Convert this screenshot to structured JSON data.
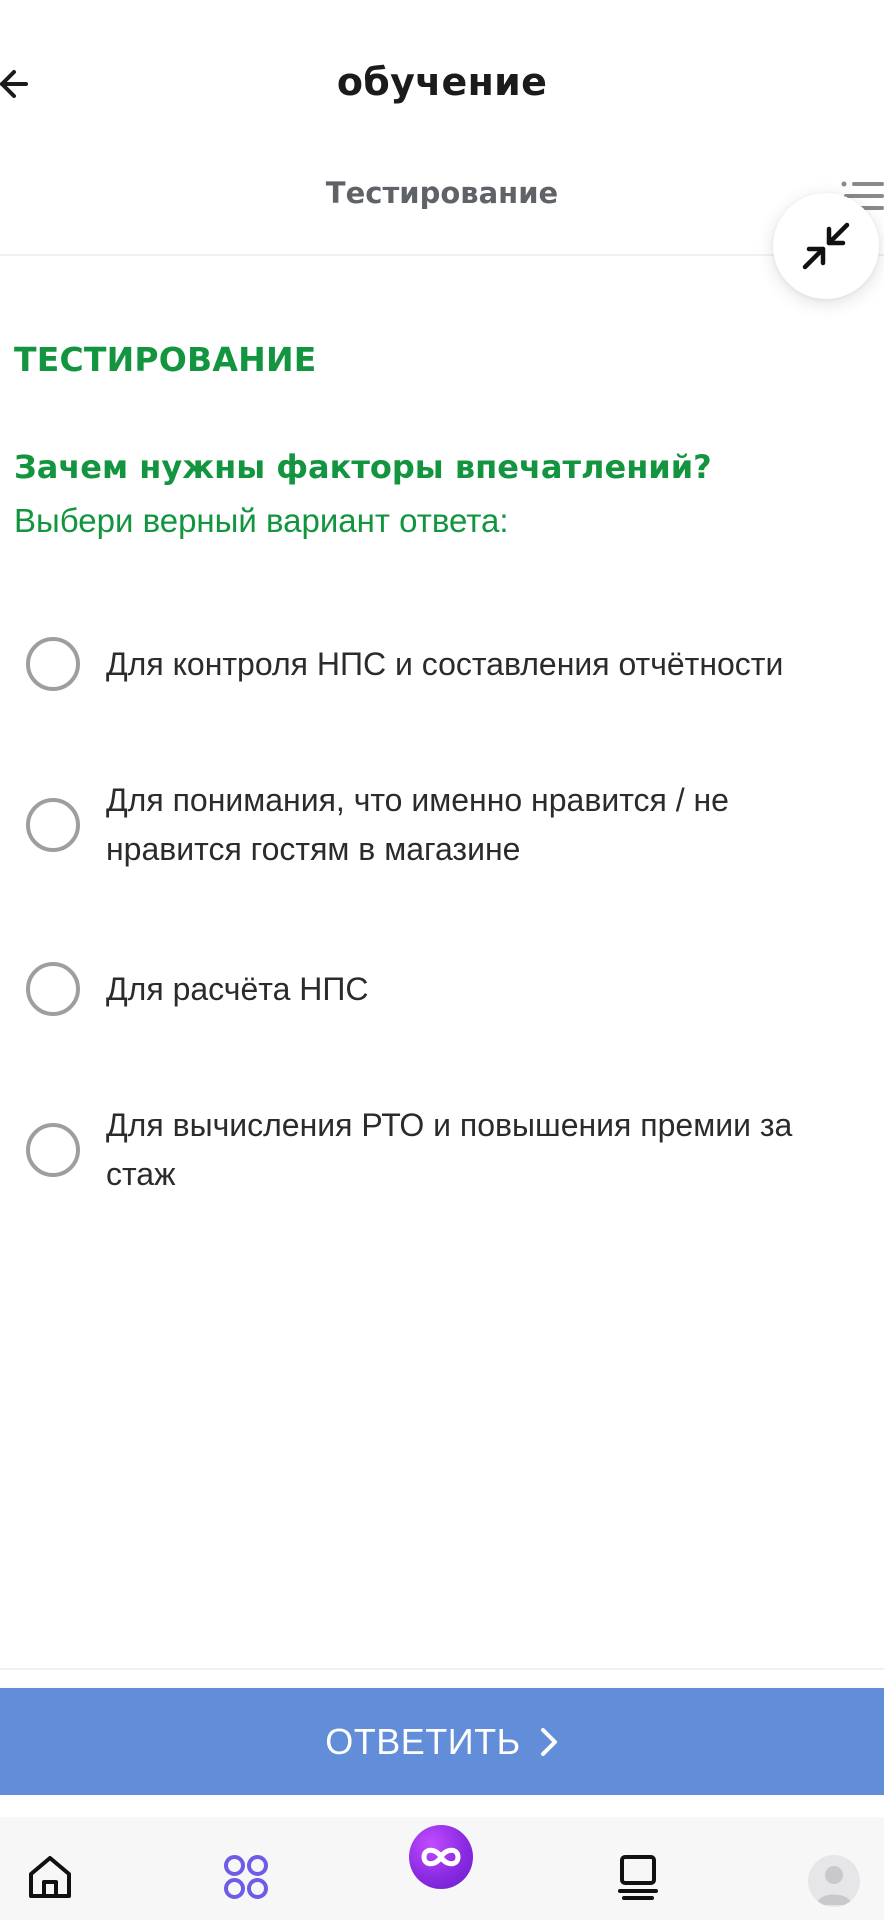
{
  "header": {
    "title": "обучение",
    "section": "Тестирование",
    "back_icon": "arrow-left-icon",
    "menu_icon": "list-icon",
    "collapse_icon": "minimize-icon"
  },
  "content": {
    "heading": "ТЕСТИРОВАНИЕ",
    "question": "Зачем нужны факторы впечатлений?",
    "instruction": "Выбери верный вариант ответа:",
    "options": [
      {
        "label": "Для контроля НПС и составления отчётности",
        "selected": false
      },
      {
        "label": "Для понимания, что именно нравится / не нравится гостям в магазине",
        "selected": false
      },
      {
        "label": "Для расчёта НПС",
        "selected": false
      },
      {
        "label": "Для вычисления РТО и повышения премии за стаж",
        "selected": false
      }
    ]
  },
  "footer": {
    "answer_label": "ОТВЕТИТЬ",
    "answer_icon": "chevron-right-icon"
  },
  "tabbar": {
    "items": [
      {
        "icon": "home-icon"
      },
      {
        "icon": "grid-icon"
      },
      {
        "icon": "infinity-icon"
      },
      {
        "icon": "book-icon"
      },
      {
        "icon": "avatar-icon"
      }
    ]
  },
  "colors": {
    "accent_green": "#13953f",
    "button_blue": "#628ed9",
    "tab_purple": "#6c5ce7",
    "center_purple": "#8a2be2"
  }
}
